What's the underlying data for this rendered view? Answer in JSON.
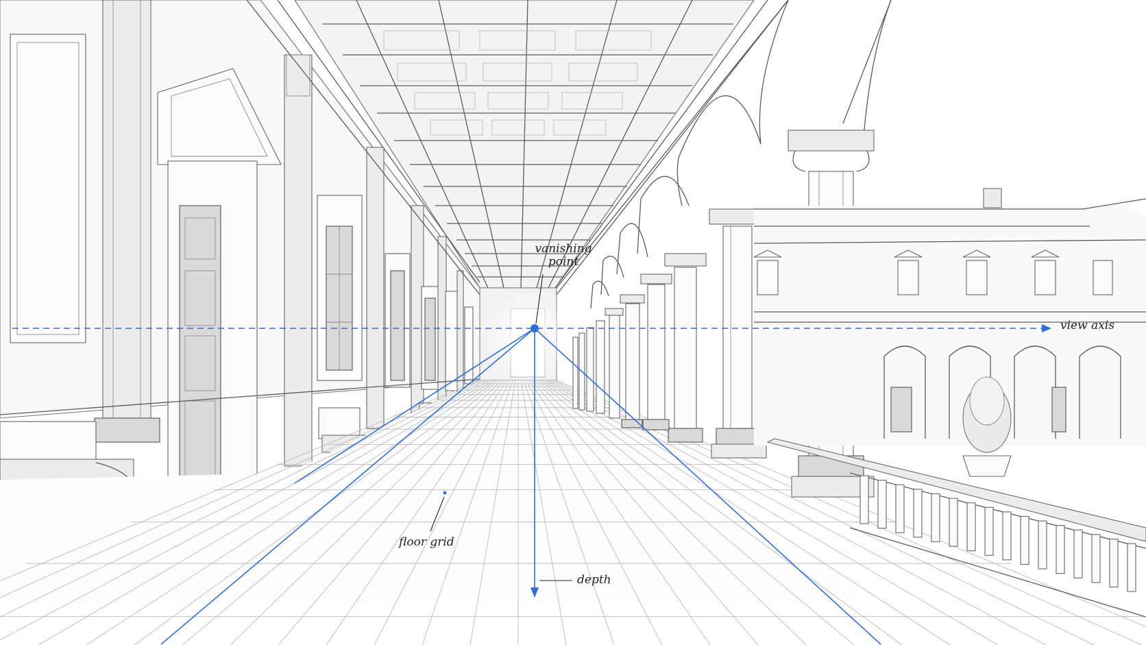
{
  "annotations": {
    "vanishing_point": {
      "line1": "vanishing",
      "line2": "point"
    },
    "view_axis": "view axis",
    "floor_grid": "floor grid",
    "depth": "depth"
  },
  "colors": {
    "guide": "#2f6fd6",
    "pencil": "#5b5b5b",
    "paper": "#ffffff"
  }
}
